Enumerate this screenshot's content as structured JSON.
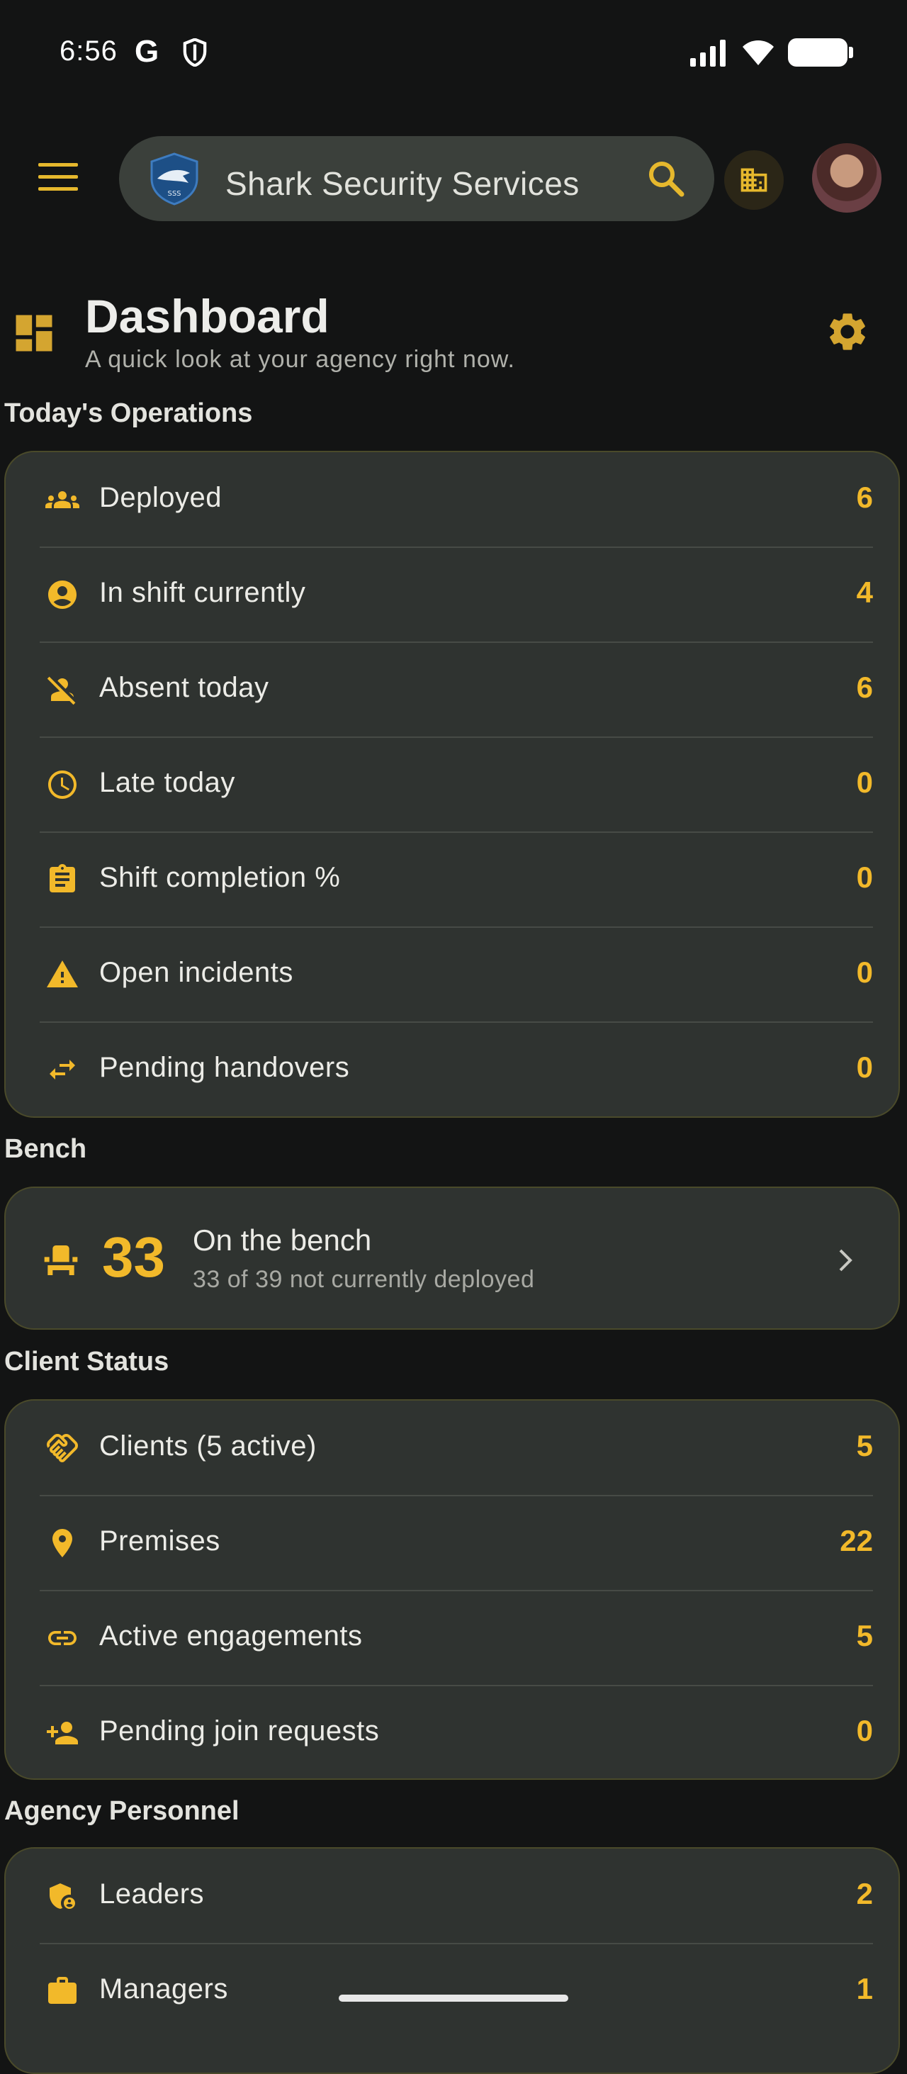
{
  "status_bar": {
    "time": "6:56",
    "g_glyph": "G"
  },
  "app_bar": {
    "menu_icon": "hamburger-menu-icon",
    "org_name": "Shark Security Services",
    "search_icon": "search-icon",
    "building_icon": "building-icon"
  },
  "dashboard": {
    "title": "Dashboard",
    "subtitle": "A quick look at your agency right now.",
    "settings_icon": "gear-icon"
  },
  "sections": {
    "operations": "Today's Operations",
    "bench": "Bench",
    "clients": "Client Status",
    "personnel": "Agency Personnel"
  },
  "operations": [
    {
      "icon": "groups-icon",
      "label": "Deployed",
      "value": "6"
    },
    {
      "icon": "account-circle-icon",
      "label": "In shift currently",
      "value": "4"
    },
    {
      "icon": "person-off-icon",
      "label": "Absent today",
      "value": "6"
    },
    {
      "icon": "clock-icon",
      "label": "Late today",
      "value": "0"
    },
    {
      "icon": "clipboard-icon",
      "label": "Shift completion %",
      "value": "0"
    },
    {
      "icon": "warning-icon",
      "label": "Open incidents",
      "value": "0"
    },
    {
      "icon": "swap-arrows-icon",
      "label": "Pending handovers",
      "value": "0"
    }
  ],
  "bench": {
    "count": "33",
    "title": "On the bench",
    "subtitle": "33 of 39 not currently deployed"
  },
  "clients": [
    {
      "icon": "handshake-icon",
      "label": "Clients (5 active)",
      "value": "5"
    },
    {
      "icon": "location-pin-icon",
      "label": "Premises",
      "value": "22"
    },
    {
      "icon": "link-icon",
      "label": "Active engagements",
      "value": "5"
    },
    {
      "icon": "person-add-icon",
      "label": "Pending join requests",
      "value": "0"
    }
  ],
  "personnel": [
    {
      "icon": "shield-person-icon",
      "label": "Leaders",
      "value": "2"
    },
    {
      "icon": "briefcase-icon",
      "label": "Managers",
      "value": "1"
    }
  ],
  "colors": {
    "accent": "#f2b92a",
    "card": "#2f3330",
    "background": "#131414"
  }
}
